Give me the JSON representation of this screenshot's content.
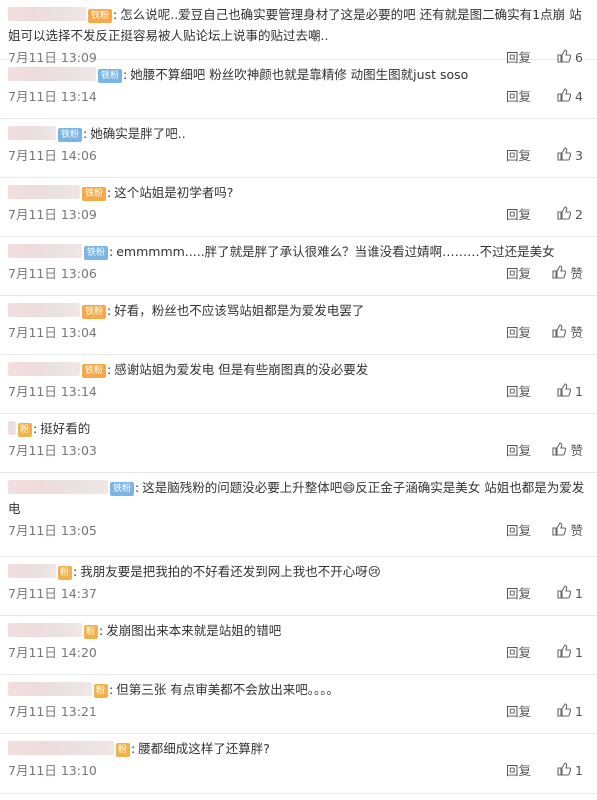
{
  "reply_label": "回复",
  "comments": [
    {
      "badge": "铁粉",
      "badge_style": "orange",
      "text": "怎么说呢..爱豆自己也确实要管理身材了这是必要的吧 还有就是图二确实有1点崩 站姐可以选择不发反正挺容易被人贴论坛上说事的贴过去嘲..",
      "time": "7月11日 13:09",
      "likes": "6"
    },
    {
      "badge": "铁粉",
      "badge_style": "blue",
      "text": "她腰不算细吧 粉丝吹神颜也就是靠精修 动图生图就just soso",
      "time": "7月11日 13:14",
      "likes": "4"
    },
    {
      "badge": "铁粉",
      "badge_style": "blue",
      "text": "她确实是胖了吧..",
      "time": "7月11日 14:06",
      "likes": "3"
    },
    {
      "badge": "铁粉",
      "badge_style": "orange",
      "text": "这个站姐是初学者吗?",
      "time": "7月11日 13:09",
      "likes": "2"
    },
    {
      "badge": "铁粉",
      "badge_style": "blue",
      "text": "emmmmm.....胖了就是胖了承认很难么？当谁没看过婧啊………不过还是美女",
      "time": "7月11日 13:06",
      "likes": "赞"
    },
    {
      "badge": "铁粉",
      "badge_style": "orange",
      "text": "好看，粉丝也不应该骂站姐都是为爱发电罢了",
      "time": "7月11日 13:04",
      "likes": "赞"
    },
    {
      "badge": "铁粉",
      "badge_style": "orange",
      "text": "感谢站姐为爱发电 但是有些崩图真的没必要发",
      "time": "7月11日 13:14",
      "likes": "1"
    },
    {
      "badge": "",
      "badge_style": "fan",
      "text": "挺好看的",
      "time": "7月11日 13:03",
      "likes": "赞"
    },
    {
      "badge": "铁粉",
      "badge_style": "blue",
      "text": "这是脑残粉的问题没必要上升整体吧😄反正金子涵确实是美女 站姐也都是为爱发电",
      "time": "7月11日 13:05",
      "likes": "赞"
    },
    {
      "badge": "",
      "badge_style": "fan",
      "text": "我朋友要是把我拍的不好看还发到网上我也不开心呀😢",
      "time": "7月11日 14:37",
      "likes": "1"
    },
    {
      "badge": "",
      "badge_style": "fan",
      "text": "发崩图出来本来就是站姐的错吧",
      "time": "7月11日 14:20",
      "likes": "1"
    },
    {
      "badge": "",
      "badge_style": "fan",
      "text": "但第三张 有点审美都不会放出来吧。。。。",
      "time": "7月11日 13:21",
      "likes": "1"
    },
    {
      "badge": "",
      "badge_style": "fan",
      "text": "腰都细成这样了还算胖?",
      "time": "7月11日 13:10",
      "likes": "1"
    }
  ]
}
